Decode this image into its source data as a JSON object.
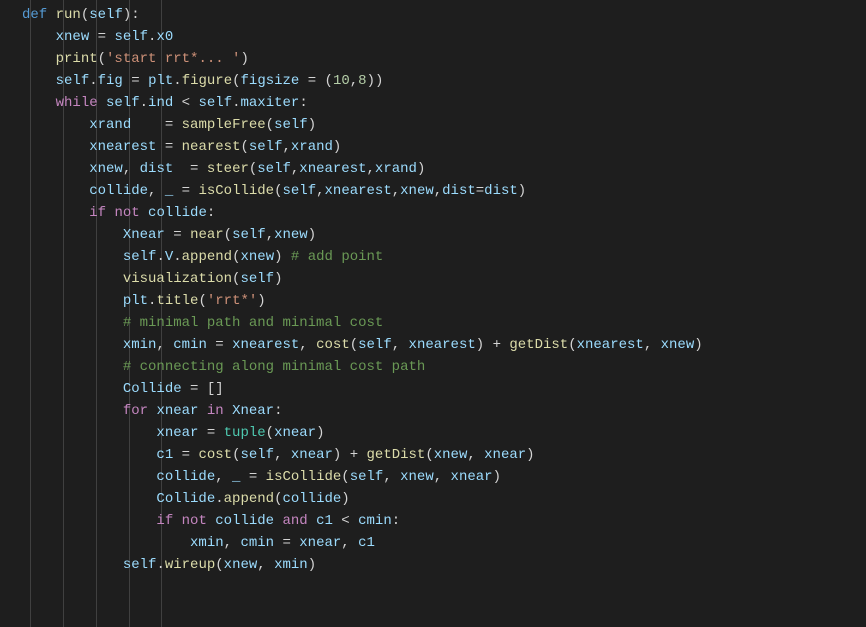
{
  "code": {
    "lines": [
      {
        "i": 0,
        "def": "def ",
        "run": "run",
        "selfp": "self",
        "rest": "(",
        "rest2": "):"
      },
      {
        "i": 1,
        "xnew": "xnew",
        "eq": " = ",
        "self": "self",
        "dot": ".",
        "x0": "x0"
      },
      {
        "i": 1,
        "print": "print",
        "lp": "(",
        "s": "'start rrt*... '",
        "rp": ")"
      },
      {
        "i": 1,
        "self": "self",
        "dot": ".",
        "fig": "fig",
        "eq": " = ",
        "plt": "plt",
        "fn": "figure",
        "lp": "(",
        "figsize": "figsize",
        "eq2": " = (",
        "n1": "10",
        "c": ",",
        "n2": "8",
        "rp": "))"
      },
      {
        "i": 1,
        "while": "while ",
        "self": "self",
        "dot": ".",
        "ind": "ind",
        "lt": " < ",
        "self2": "self",
        "dot2": ".",
        "maxiter": "maxiter",
        "col": ":"
      },
      {
        "i": 2,
        "xrand": "xrand",
        "sp": "    = ",
        "fn": "sampleFree",
        "lp": "(",
        "self": "self",
        "rp": ")"
      },
      {
        "i": 2,
        "xnearest": "xnearest",
        "sp": " = ",
        "fn": "nearest",
        "lp": "(",
        "self": "self",
        "c": ",",
        "xrand": "xrand",
        "rp": ")"
      },
      {
        "i": 2,
        "xnew": "xnew",
        "c1": ", ",
        "dist": "dist",
        "sp": "  = ",
        "fn": "steer",
        "lp": "(",
        "self": "self",
        "c": ",",
        "xnearest": "xnearest",
        "c2": ",",
        "xrand": "xrand",
        "rp": ")"
      },
      {
        "i": 2,
        "collide": "collide",
        "c1": ", ",
        "u": "_",
        "sp": " = ",
        "fn": "isCollide",
        "lp": "(",
        "self": "self",
        "c": ",",
        "xnearest": "xnearest",
        "c2": ",",
        "xnew": "xnew",
        "c3": ",",
        "distk": "dist",
        "eq": "=",
        "distv": "dist",
        "rp": ")"
      },
      {
        "i": 2,
        "if": "if ",
        "not": "not ",
        "collide": "collide",
        "col": ":"
      },
      {
        "i": 3,
        "Xnear": "Xnear",
        "eq": " = ",
        "fn": "near",
        "lp": "(",
        "self": "self",
        "c": ",",
        "xnew": "xnew",
        "rp": ")"
      },
      {
        "i": 3,
        "self": "self",
        "dot": ".",
        "V": "V",
        "dot2": ".",
        "append": "append",
        "lp": "(",
        "xnew": "xnew",
        "rp": ") ",
        "cmt": "# add point"
      },
      {
        "i": 3,
        "fn": "visualization",
        "lp": "(",
        "self": "self",
        "rp": ")"
      },
      {
        "i": 3,
        "plt": "plt",
        "dot": ".",
        "title": "title",
        "lp": "(",
        "s": "'rrt*'",
        "rp": ")"
      },
      {
        "i": 3,
        "cmt": "# minimal path and minimal cost"
      },
      {
        "i": 3,
        "xmin": "xmin",
        "c1": ", ",
        "cmin": "cmin",
        "eq": " = ",
        "xnearest": "xnearest",
        "c2": ", ",
        "cost": "cost",
        "lp": "(",
        "self": "self",
        "c3": ", ",
        "xnearest2": "xnearest",
        "rp": ") + ",
        "gd": "getDist",
        "lp2": "(",
        "xnearest3": "xnearest",
        "c4": ", ",
        "xnew": "xnew",
        "rp2": ")"
      },
      {
        "i": 3,
        "cmt": "# connecting along minimal cost path"
      },
      {
        "i": 3,
        "Collide": "Collide",
        "eq": " = []"
      },
      {
        "i": 3,
        "for": "for ",
        "xnear": "xnear",
        "in": " in ",
        "Xnear": "Xnear",
        "col": ":"
      },
      {
        "i": 4,
        "xnear": "xnear",
        "eq": " = ",
        "tuple": "tuple",
        "lp": "(",
        "xnear2": "xnear",
        "rp": ")"
      },
      {
        "i": 4,
        "c1v": "c1",
        "eq": " = ",
        "cost": "cost",
        "lp": "(",
        "self": "self",
        "c1": ", ",
        "xnear": "xnear",
        "rp": ") + ",
        "gd": "getDist",
        "lp2": "(",
        "xnew": "xnew",
        "c2": ", ",
        "xnear2": "xnear",
        "rp2": ")"
      },
      {
        "i": 4,
        "collide": "collide",
        "c1": ", ",
        "u": "_",
        "eq": " = ",
        "fn": "isCollide",
        "lp": "(",
        "self": "self",
        "c2": ", ",
        "xnew": "xnew",
        "c3": ", ",
        "xnear": "xnear",
        "rp": ")"
      },
      {
        "i": 4,
        "Collide": "Collide",
        "dot": ".",
        "append": "append",
        "lp": "(",
        "collide": "collide",
        "rp": ")"
      },
      {
        "i": 4,
        "if": "if ",
        "not": "not ",
        "collide": "collide",
        "and": " and ",
        "c1v": "c1",
        "lt": " < ",
        "cmin": "cmin",
        "col": ":"
      },
      {
        "i": 5,
        "xmin": "xmin",
        "c1": ", ",
        "cmin": "cmin",
        "eq": " = ",
        "xnear": "xnear",
        "c2": ", ",
        "c1v": "c1"
      },
      {
        "i": 3,
        "self": "self",
        "dot": ".",
        "wireup": "wireup",
        "lp": "(",
        "xnew": "xnew",
        "c": ", ",
        "xmin": "xmin",
        "rp": ")"
      }
    ],
    "indent": "    "
  }
}
